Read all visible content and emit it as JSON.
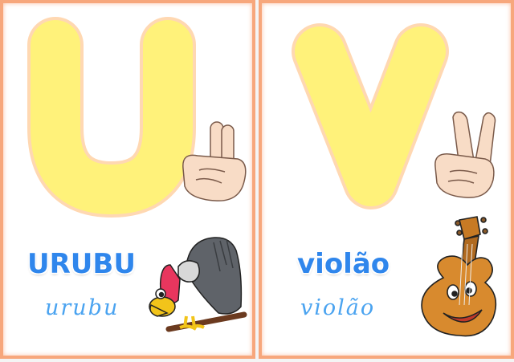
{
  "cards": [
    {
      "letter": "U",
      "word": "URUBU",
      "word_cursive": "urubu",
      "picture": "vulture-illustration",
      "hand_sign": "libras-u-hand-sign-icon"
    },
    {
      "letter": "V",
      "word": "violão",
      "word_cursive": "violão",
      "picture": "guitar-illustration",
      "hand_sign": "libras-v-hand-sign-icon"
    }
  ],
  "colors": {
    "letter_fill": "#fff27a",
    "letter_glow": "#ffc07a",
    "card_border": "#f7a77c",
    "word_print": "#2f86ec",
    "word_cursive": "#4aa3f0"
  }
}
